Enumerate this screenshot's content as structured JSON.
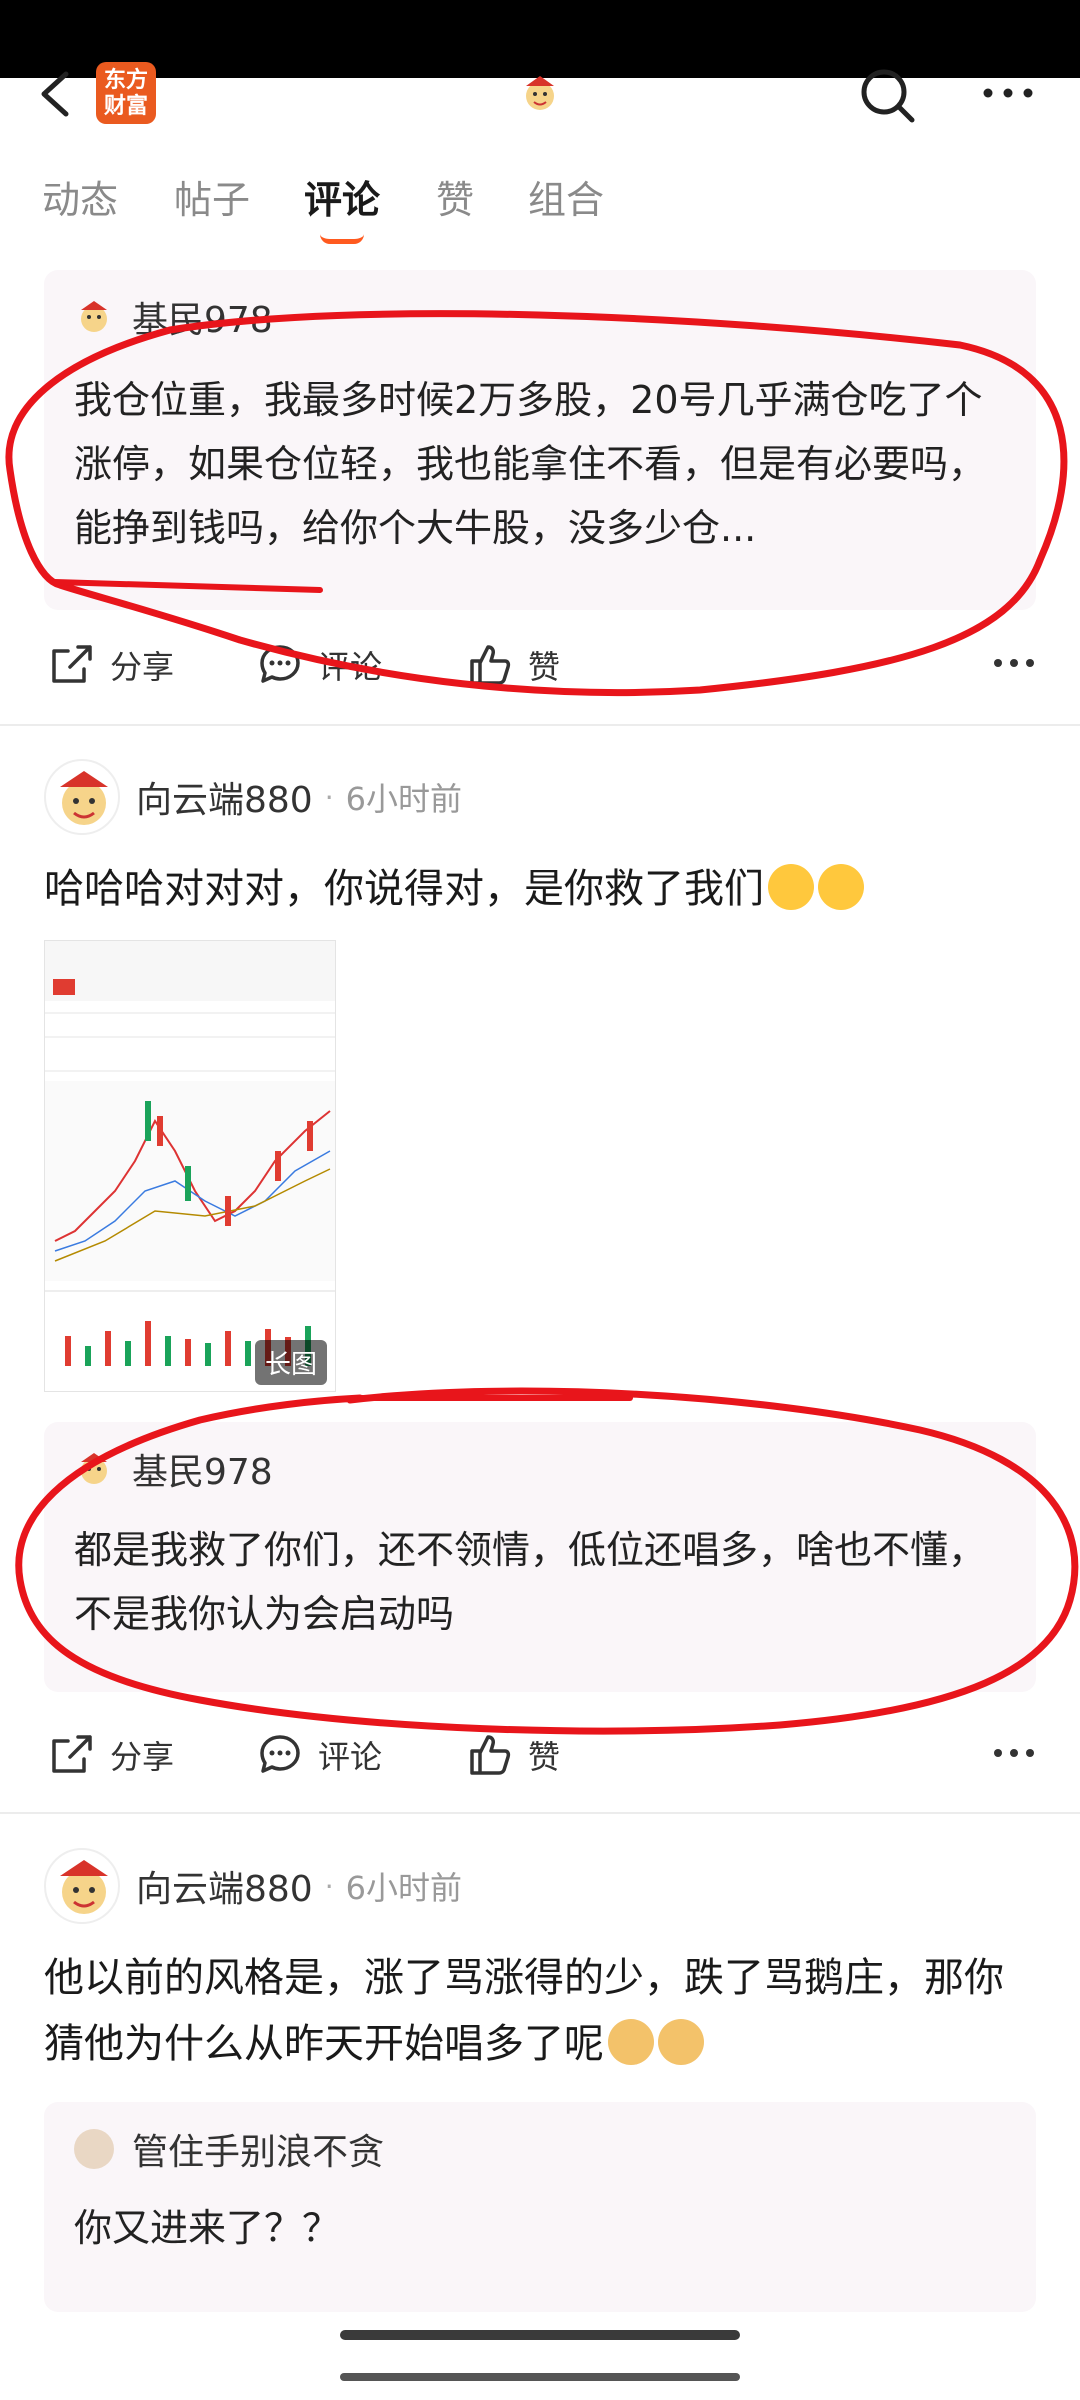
{
  "header": {
    "logo_text": "东方财富",
    "back_icon": "chevron-left-icon",
    "search_icon": "search-icon",
    "more_icon": "more-horizontal-icon"
  },
  "tabs": [
    {
      "label": "动态",
      "active": false
    },
    {
      "label": "帖子",
      "active": false
    },
    {
      "label": "评论",
      "active": true
    },
    {
      "label": "赞",
      "active": false
    },
    {
      "label": "组合",
      "active": false
    }
  ],
  "accent_color": "#ff5a1f",
  "annotation_color": "#e8151b",
  "item1": {
    "quote": {
      "author": "基民978",
      "text": "我仓位重，我最多时候2万多股，20号几乎满仓吃了个涨停，如果仓位轻，我也能拿住不看，但是有必要吗，能挣到钱吗，给你个大牛股，没多少仓..."
    },
    "actions": {
      "share": "分享",
      "comment": "评论",
      "like": "赞"
    }
  },
  "item2": {
    "author": "向云端880",
    "time": "6小时前",
    "text": "哈哈哈对对对，你说得对，是你救了我们",
    "emoji": "grin-emoji",
    "chart_badge": "长图",
    "quote": {
      "author": "基民978",
      "text": "都是我救了你们，还不领情，低位还唱多，啥也不懂，不是我你认为会启动吗"
    },
    "actions": {
      "share": "分享",
      "comment": "评论",
      "like": "赞"
    }
  },
  "item3": {
    "author": "向云端880",
    "time": "6小时前",
    "text": "他以前的风格是，涨了骂涨得的少，跌了骂鹅庄，那你猜他为什么从昨天开始唱多了呢",
    "emoji": "doge-emoji",
    "quote": {
      "author": "管住手别浪不贪",
      "text": "你又进来了？？"
    }
  }
}
